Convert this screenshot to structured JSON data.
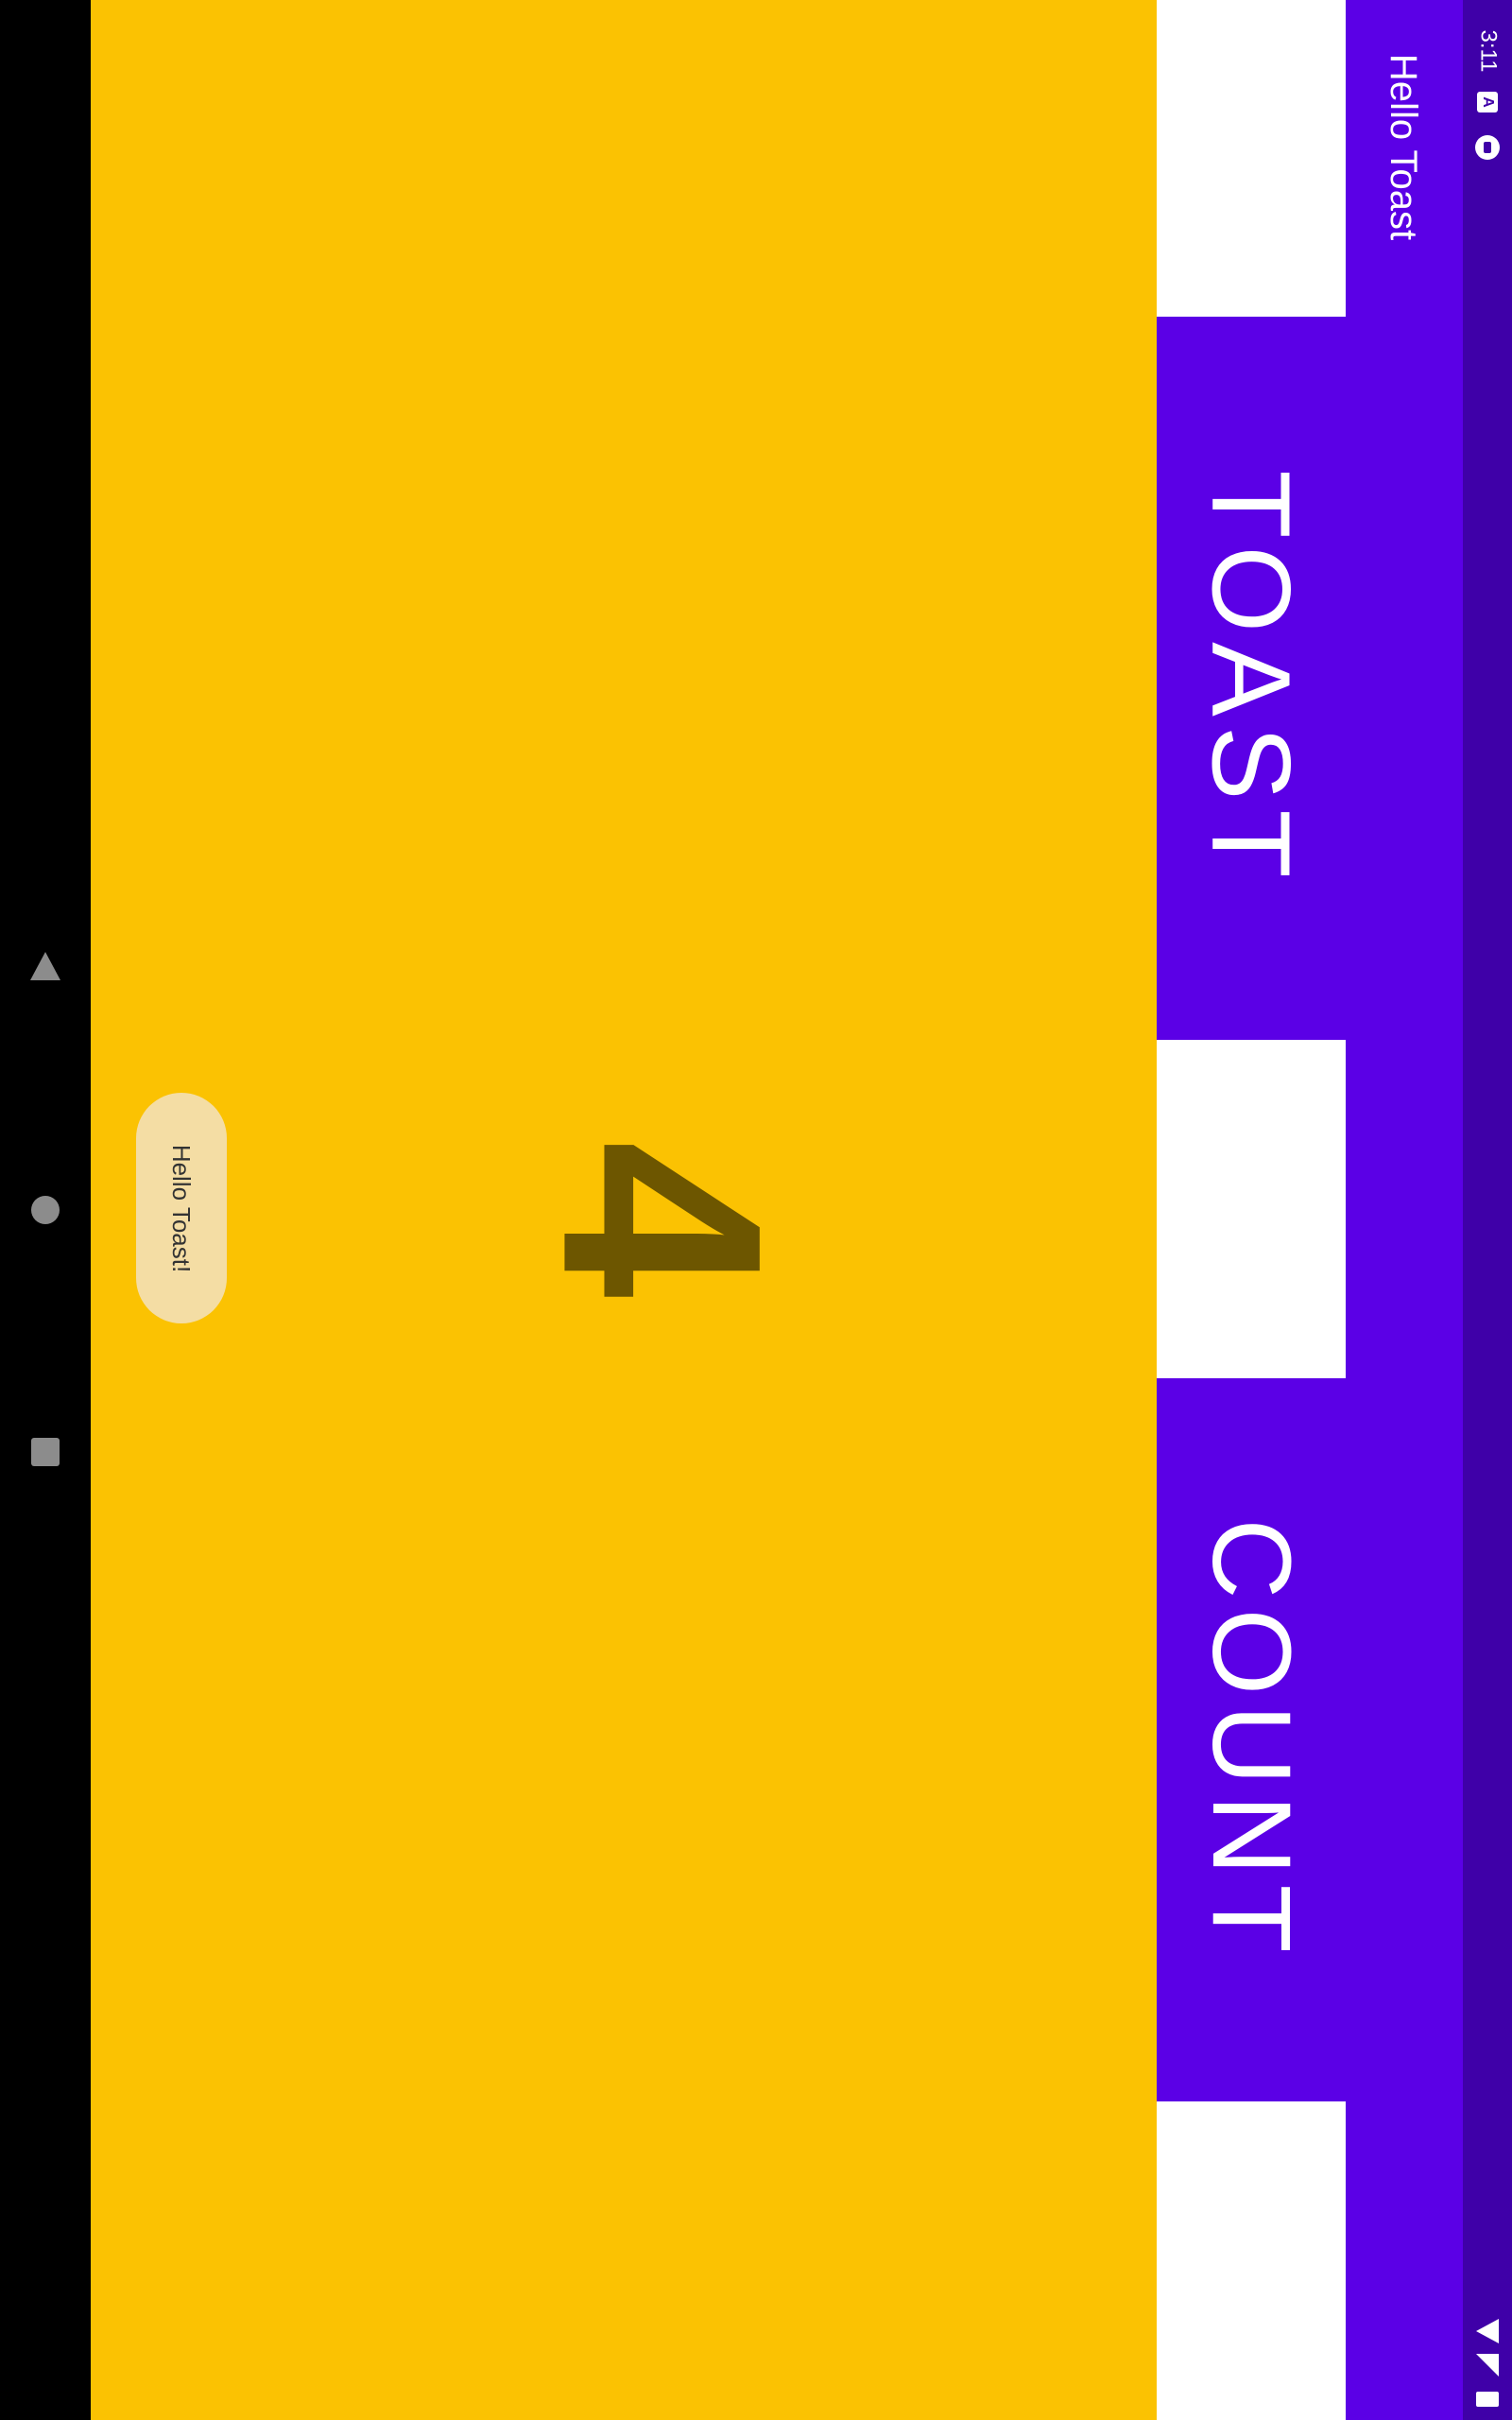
{
  "app": {
    "title": "Hello Toast"
  },
  "status_bar": {
    "time": "3:11",
    "icons": [
      "a-notification-icon",
      "sync-icon",
      "wifi-icon",
      "signal-icon",
      "battery-icon"
    ]
  },
  "buttons": {
    "toast_label": "TOAST",
    "count_label": "COUNT"
  },
  "counter": {
    "value": "4"
  },
  "toast": {
    "message": "Hello Toast!"
  },
  "nav": {
    "icons": [
      "back-icon",
      "home-icon",
      "recents-icon"
    ]
  },
  "colors": {
    "primary": "#5B00E6",
    "primary_dark": "#3F00A8",
    "background": "#FBC202",
    "count_text": "#6D5600",
    "toast_bg": "#F4DDA4"
  }
}
